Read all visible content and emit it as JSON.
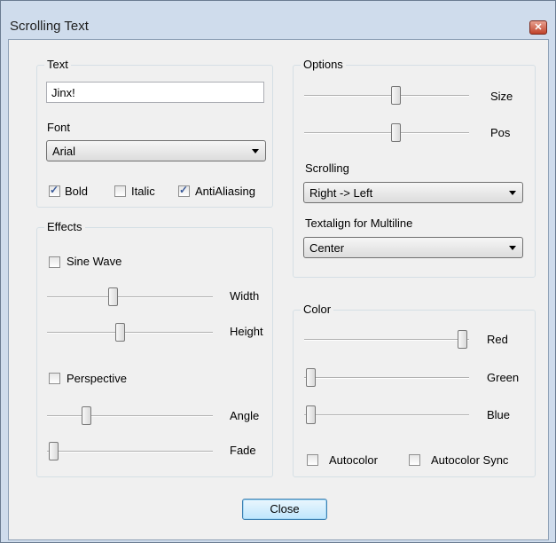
{
  "window": {
    "title": "Scrolling Text"
  },
  "text_group": {
    "label": "Text",
    "input_value": "Jinx!",
    "font_label": "Font",
    "font_value": "Arial",
    "bold": {
      "label": "Bold",
      "checked": true
    },
    "italic": {
      "label": "Italic",
      "checked": false
    },
    "antialiasing": {
      "label": "AntiAliasing",
      "checked": true
    }
  },
  "effects_group": {
    "label": "Effects",
    "sine_wave": {
      "label": "Sine Wave",
      "checked": false
    },
    "width": {
      "label": "Width",
      "value": 0.38
    },
    "height": {
      "label": "Height",
      "value": 0.43
    },
    "perspective": {
      "label": "Perspective",
      "checked": false
    },
    "angle": {
      "label": "Angle",
      "value": 0.2
    },
    "fade": {
      "label": "Fade",
      "value": 0.0
    }
  },
  "options_group": {
    "label": "Options",
    "size": {
      "label": "Size",
      "value": 0.55
    },
    "pos": {
      "label": "Pos",
      "value": 0.55
    },
    "scrolling_label": "Scrolling",
    "scrolling_value": "Right -> Left",
    "textalign_label": "Textalign for Multiline",
    "textalign_value": "Center"
  },
  "color_group": {
    "label": "Color",
    "red": {
      "label": "Red",
      "value": 1.0
    },
    "green": {
      "label": "Green",
      "value": 0.0
    },
    "blue": {
      "label": "Blue",
      "value": 0.0
    },
    "autocolor": {
      "label": "Autocolor",
      "checked": false
    },
    "autocolor_sync": {
      "label": "Autocolor Sync",
      "checked": false
    }
  },
  "close_button": "Close"
}
